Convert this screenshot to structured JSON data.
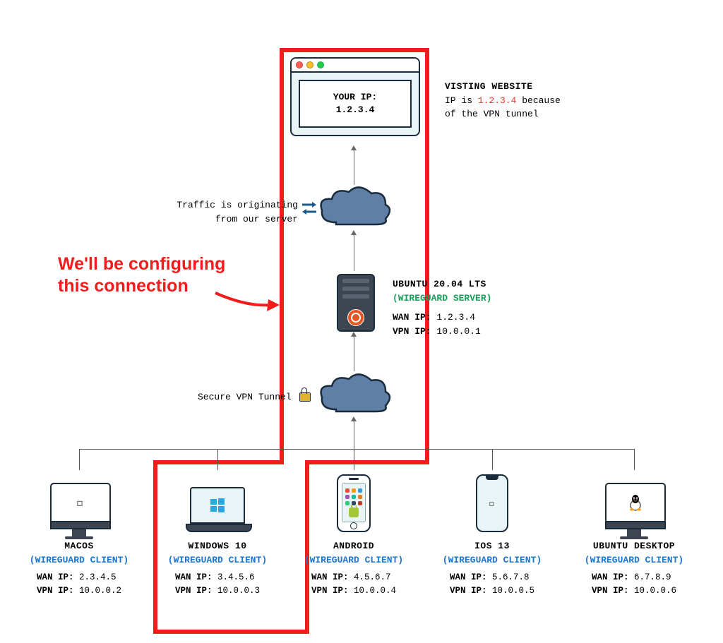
{
  "browser": {
    "line1": "YOUR IP:",
    "line2": "1.2.3.4"
  },
  "website_note": {
    "title": "VISTING WEBSITE",
    "line1_a": "IP is ",
    "ip": "1.2.3.4",
    "line1_b": " because",
    "line2": "of the VPN tunnel"
  },
  "traffic_note": {
    "line1": "Traffic is originating",
    "line2": "from our server"
  },
  "callout": {
    "line1": "We'll be configuring",
    "line2": "this connection"
  },
  "server_note": {
    "os": "UBUNTU 20.04 LTS",
    "role": "(WIREGUARD SERVER)",
    "wan_label": "WAN IP:",
    "wan": "1.2.3.4",
    "vpn_label": "VPN IP:",
    "vpn": "10.0.0.1"
  },
  "tunnel_label": "Secure VPN Tunnel",
  "client_role": "(WIREGUARD CLIENT)",
  "wan_label": "WAN IP:",
  "vpn_label": "VPN IP:",
  "clients": [
    {
      "name": "MACOS",
      "wan": "2.3.4.5",
      "vpn": "10.0.0.2"
    },
    {
      "name": "WINDOWS 10",
      "wan": "3.4.5.6",
      "vpn": "10.0.0.3"
    },
    {
      "name": "ANDROID",
      "wan": "4.5.6.7",
      "vpn": "10.0.0.4"
    },
    {
      "name": "IOS 13",
      "wan": "5.6.7.8",
      "vpn": "10.0.0.5"
    },
    {
      "name": "UBUNTU DESKTOP",
      "wan": "6.7.8.9",
      "vpn": "10.0.0.6"
    }
  ]
}
